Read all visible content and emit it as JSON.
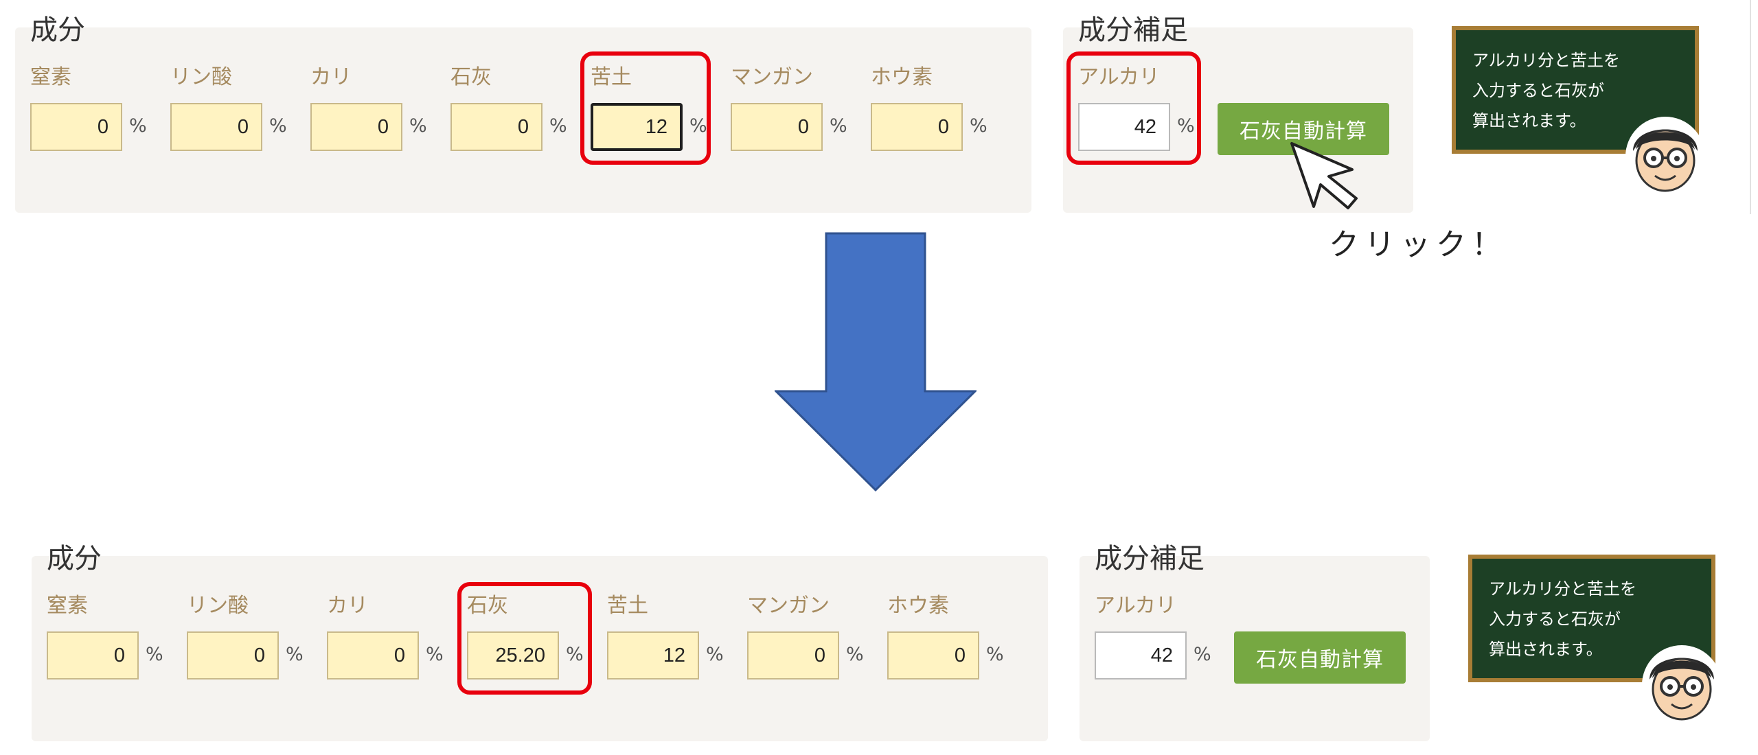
{
  "before": {
    "components": {
      "title": "成分",
      "fields": [
        {
          "label": "窒素",
          "value": "0",
          "unit": "%"
        },
        {
          "label": "リン酸",
          "value": "0",
          "unit": "%"
        },
        {
          "label": "カリ",
          "value": "0",
          "unit": "%"
        },
        {
          "label": "石灰",
          "value": "0",
          "unit": "%"
        },
        {
          "label": "苦土",
          "value": "12",
          "unit": "%"
        },
        {
          "label": "マンガン",
          "value": "0",
          "unit": "%"
        },
        {
          "label": "ホウ素",
          "value": "0",
          "unit": "%"
        }
      ]
    },
    "supplement": {
      "title": "成分補足",
      "alkali_label": "アルカリ",
      "alkali_value": "42",
      "unit": "%",
      "button_label": "石灰自動計算"
    }
  },
  "after": {
    "components": {
      "title": "成分",
      "fields": [
        {
          "label": "窒素",
          "value": "0",
          "unit": "%"
        },
        {
          "label": "リン酸",
          "value": "0",
          "unit": "%"
        },
        {
          "label": "カリ",
          "value": "0",
          "unit": "%"
        },
        {
          "label": "石灰",
          "value": "25.20",
          "unit": "%"
        },
        {
          "label": "苦土",
          "value": "12",
          "unit": "%"
        },
        {
          "label": "マンガン",
          "value": "0",
          "unit": "%"
        },
        {
          "label": "ホウ素",
          "value": "0",
          "unit": "%"
        }
      ]
    },
    "supplement": {
      "title": "成分補足",
      "alkali_label": "アルカリ",
      "alkali_value": "42",
      "unit": "%",
      "button_label": "石灰自動計算"
    }
  },
  "tip": {
    "lines": [
      "アルカリ分と苦土を",
      "入力すると石灰が",
      "算出されます。"
    ]
  },
  "click_label": "クリック！",
  "colors": {
    "panel_bg": "#f5f3f0",
    "label": "#a58a5f",
    "input_bg": "#fff3c2",
    "button": "#76a842",
    "highlight": "#e8000d",
    "arrow": "#4472c4",
    "board": "#1d4025",
    "board_frame": "#a87d35"
  },
  "icons": {
    "cursor": "mouse-pointer-icon",
    "arrow": "down-arrow-icon",
    "avatar": "glasses-man-avatar"
  }
}
